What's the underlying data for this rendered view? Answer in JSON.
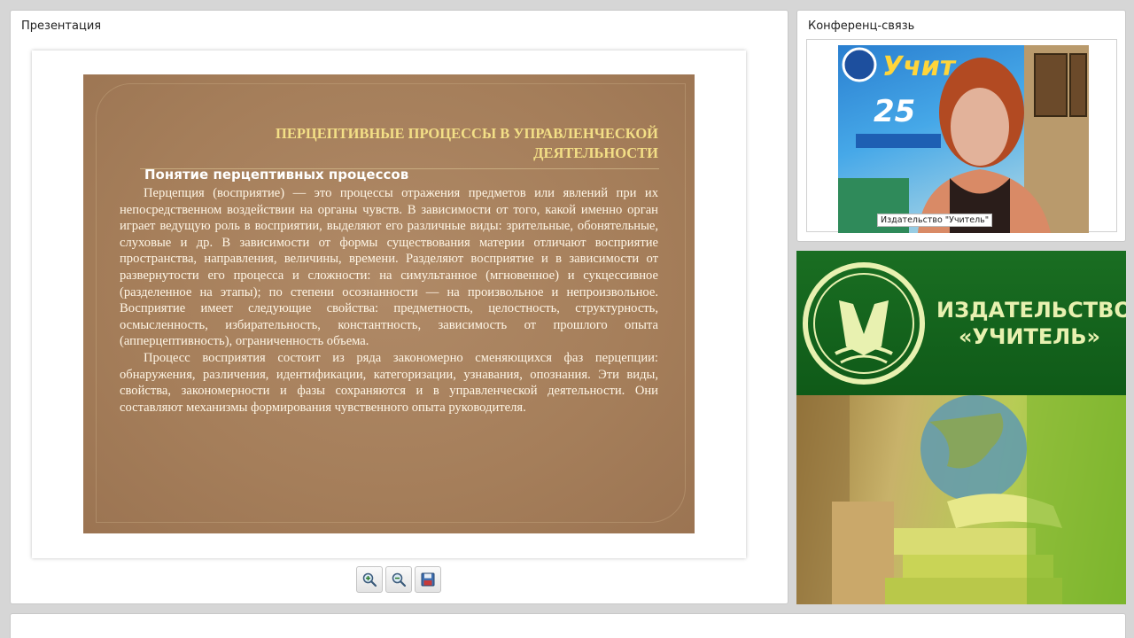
{
  "presentation": {
    "title": "Презентация",
    "slide": {
      "title": "ПЕРЦЕПТИВНЫЕ ПРОЦЕССЫ В УПРАВЛЕНЧЕСКОЙ ДЕЯТЕЛЬНОСТИ",
      "subtitle": "Понятие перцептивных процессов",
      "paragraphs": [
        "Перцепция (восприятие) — это процессы отражения предметов или явлений при их непосредственном воздействии на органы чувств. В зависимости от того, какой именно орган играет ведущую роль в восприятии, выделяют его различные виды: зрительные, обонятельные, слуховые и др. В зависимости от формы существования материи отличают восприятие пространства, направления, величины, времени. Разделяют восприятие и в зависимости от развернутости его процесса и сложности: на симультанное (мгновенное) и сукцессивное (разделенное на этапы); по степени осознанности — на произвольное и непроизвольное. Восприятие имеет следующие свойства: предметность, целостность, структурность, осмысленность, избирательность, константность, зависимость от прошлого опыта (апперцептивность), ограниченность объема.",
        "Процесс восприятия состоит из ряда закономерно сменяющихся фаз перцепции: обнаружения, различения, идентификации, категоризации, узнавания, опознания. Эти виды, свойства, закономерности и фазы сохраняются и в управленческой деятельности. Они составляют механизмы формирования чувственного опыта руководителя."
      ]
    },
    "toolbar": {
      "zoom_in_icon": "zoom-in-icon",
      "zoom_out_icon": "zoom-out-icon",
      "save_icon": "save-icon"
    }
  },
  "conference": {
    "title": "Конференц-связь",
    "video_caption": "Издательство \"Учитель\""
  },
  "publisher": {
    "banner_text": "ИЗДАТЕЛЬСТВО «УЧИТЕЛЬ»"
  },
  "colors": {
    "slide_background": "#a57e5a",
    "slide_title": "#f3df86",
    "banner_green": "#15661d",
    "banner_text": "#e8f1b0"
  }
}
